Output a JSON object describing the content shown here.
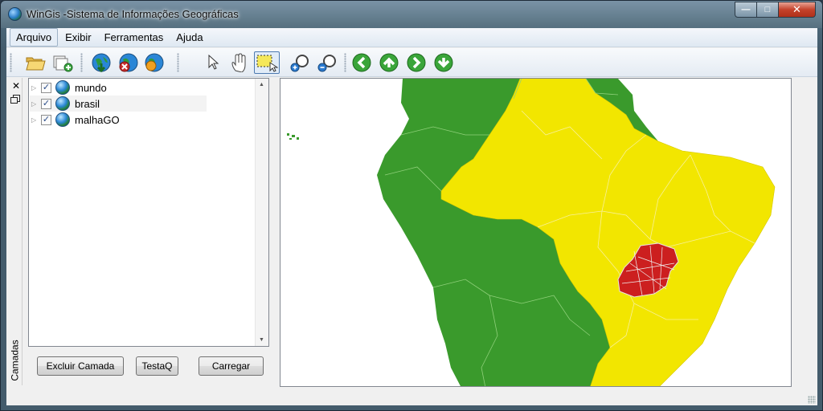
{
  "window": {
    "title": "WinGis -Sistema de Informações Geográficas",
    "controls": {
      "minimize": "—",
      "maximize": "□",
      "close": "✕"
    }
  },
  "menu": [
    "Arquivo",
    "Exibir",
    "Ferramentas",
    "Ajuda"
  ],
  "toolbar": [
    "open-folder-icon",
    "add-layer-icon",
    "globe-download-icon",
    "globe-remove-icon",
    "globe-refresh-icon",
    "pointer-arrow-icon",
    "pan-hand-icon",
    "select-rectangle-icon",
    "zoom-in-icon",
    "zoom-out-icon",
    "pan-left-icon",
    "pan-up-icon",
    "pan-right-icon",
    "pan-down-icon"
  ],
  "layers_panel": {
    "title": "Camadas",
    "layers": [
      {
        "name": "mundo",
        "checked": true
      },
      {
        "name": "brasil",
        "checked": true
      },
      {
        "name": "malhaGO",
        "checked": true
      }
    ],
    "buttons": {
      "delete_layer": "Excluir Camada",
      "test_q": "TestaQ",
      "load": "Carregar"
    }
  },
  "map": {
    "colors": {
      "world": "#3a9a2c",
      "brasil": "#f2e600",
      "goias": "#cc1f1f",
      "background": "#ffffff"
    }
  }
}
